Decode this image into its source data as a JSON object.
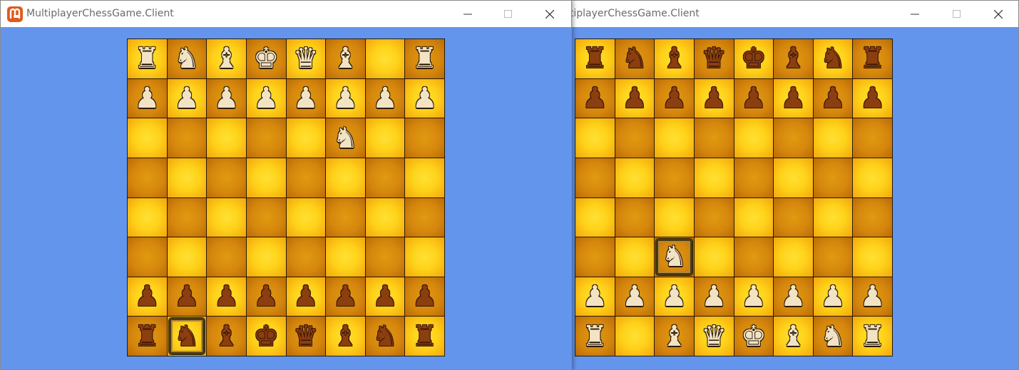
{
  "windows": [
    {
      "id": "left",
      "title": "MultiplayerChessGame.Client",
      "selected": [
        7,
        1
      ],
      "rows": [
        [
          "wR",
          "wN",
          "wB",
          "wK",
          "wQ",
          "wB",
          "",
          "wR"
        ],
        [
          "wP",
          "wP",
          "wP",
          "wP",
          "wP",
          "wP",
          "wP",
          "wP"
        ],
        [
          "",
          "",
          "",
          "",
          "",
          "wN",
          "",
          ""
        ],
        [
          "",
          "",
          "",
          "",
          "",
          "",
          "",
          ""
        ],
        [
          "",
          "",
          "",
          "",
          "",
          "",
          "",
          ""
        ],
        [
          "",
          "",
          "",
          "",
          "",
          "",
          "",
          ""
        ],
        [
          "bP",
          "bP",
          "bP",
          "bP",
          "bP",
          "bP",
          "bP",
          "bP"
        ],
        [
          "bR",
          "bN",
          "bB",
          "bK",
          "bQ",
          "bB",
          "bN",
          "bR"
        ]
      ]
    },
    {
      "id": "right",
      "title": "MultiplayerChessGame.Client",
      "selected": [
        5,
        2
      ],
      "rows": [
        [
          "bR",
          "bN",
          "bB",
          "bQ",
          "bK",
          "bB",
          "bN",
          "bR"
        ],
        [
          "bP",
          "bP",
          "bP",
          "bP",
          "bP",
          "bP",
          "bP",
          "bP"
        ],
        [
          "",
          "",
          "",
          "",
          "",
          "",
          "",
          ""
        ],
        [
          "",
          "",
          "",
          "",
          "",
          "",
          "",
          ""
        ],
        [
          "",
          "",
          "",
          "",
          "",
          "",
          "",
          ""
        ],
        [
          "",
          "",
          "wN",
          "",
          "",
          "",
          "",
          ""
        ],
        [
          "wP",
          "wP",
          "wP",
          "wP",
          "wP",
          "wP",
          "wP",
          "wP"
        ],
        [
          "wR",
          "",
          "wB",
          "wQ",
          "wK",
          "wB",
          "wN",
          "wR"
        ]
      ]
    }
  ],
  "pieces": {
    "K": {
      "name": "king",
      "glyph": "♚"
    },
    "Q": {
      "name": "queen",
      "glyph": "♛"
    },
    "R": {
      "name": "rook",
      "glyph": "♜"
    },
    "B": {
      "name": "bishop",
      "glyph": "♝"
    },
    "N": {
      "name": "knight",
      "glyph": "♞"
    },
    "P": {
      "name": "pawn",
      "glyph": "♟"
    }
  },
  "colors": {
    "client_background": "#6495ed",
    "light_square": "#ffd21a",
    "dark_square": "#d5870d",
    "white_piece": "#f2e3c4",
    "black_piece": "#8b3e10",
    "app_icon": "#e05a1c"
  },
  "icons": {
    "app": "monogame-logo-icon",
    "minimize": "minimize-icon",
    "maximize": "maximize-icon",
    "close": "close-icon"
  }
}
